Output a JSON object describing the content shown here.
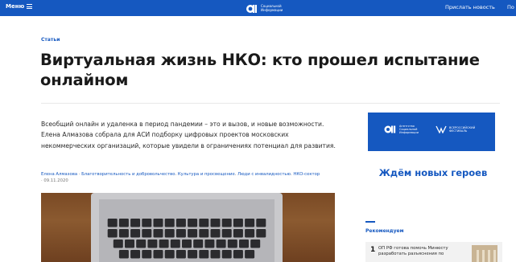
{
  "header": {
    "menu_label": "Меню",
    "logo_line1": "Социальной",
    "logo_line2": "Информации",
    "submit_news": "Прислать новость",
    "cut_item": "По"
  },
  "article": {
    "category": "Статьи",
    "title": "Виртуальная жизнь НКО: кто прошел испытание онлайном",
    "lead": "Всеобщий онлайн и удаленка в период пандемии – это и вызов, и новые возможности. Елена Алмазова собрала для АСИ подборку цифровых проектов московских некоммерческих организаций, которые увидели в ограничениях потенциал для развития.",
    "author": "Елена Алмазова",
    "tags": [
      "Благотворительность и добровольчество",
      "Культура и просвещение",
      "Люди с инвалидностью",
      "НКО-сектор"
    ],
    "date": "09.11.2020"
  },
  "sidebar": {
    "promo_logo_a": [
      "Агентство",
      "Социальной",
      "Информации"
    ],
    "promo_logo_b": [
      "ВСЕРОССИЙСКИЙ",
      "ФЕСТИВАЛЬ"
    ],
    "promo_text": "Ждём новых героев",
    "recommend_heading": "Рекомендуем",
    "recommend_items": [
      {
        "num": "1",
        "text": "ОП РФ готова помочь Минюсту разработать разъяснения по"
      }
    ]
  },
  "colors": {
    "brand_blue": "#1558c0",
    "text_dark": "#1a1a1a"
  },
  "icons": [
    "menu-icon",
    "asi-logo-icon"
  ]
}
